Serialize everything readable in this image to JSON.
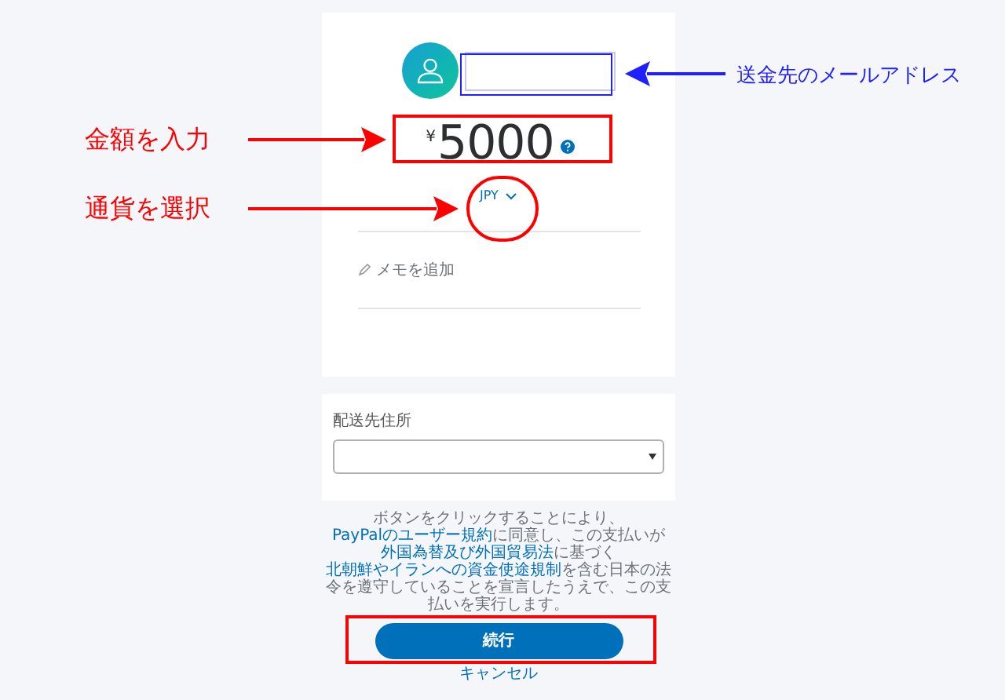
{
  "amount": {
    "symbol": "¥",
    "value": "5000"
  },
  "currency": {
    "code": "JPY"
  },
  "memo": {
    "label": "メモを追加"
  },
  "shipping": {
    "label": "配送先住所"
  },
  "terms": [
    {
      "text": "ボタンをクリックすることにより、",
      "link": false
    },
    {
      "text": "PayPalのユーザー規約",
      "link": true
    },
    {
      "text": "に同意し、この支払いが",
      "link": false
    },
    {
      "text": "外国為替及び外国貿易法",
      "link": true
    },
    {
      "text": "に基づく",
      "link": false
    },
    {
      "text": "北朝鮮やイランへの資金使途規制",
      "link": true
    },
    {
      "text": "を含む日本の法令を遵守していることを宣言したうえで、この支払いを実行します。",
      "link": false
    }
  ],
  "continue_button": "続行",
  "cancel_link": "キャンセル",
  "annotations": [
    {
      "text": "送金先のメールアドレス",
      "color": "#1f1fff"
    },
    {
      "text": "金額を入力",
      "color": "#ff0000"
    },
    {
      "text": "通貨を選択",
      "color": "#ff0000"
    }
  ]
}
